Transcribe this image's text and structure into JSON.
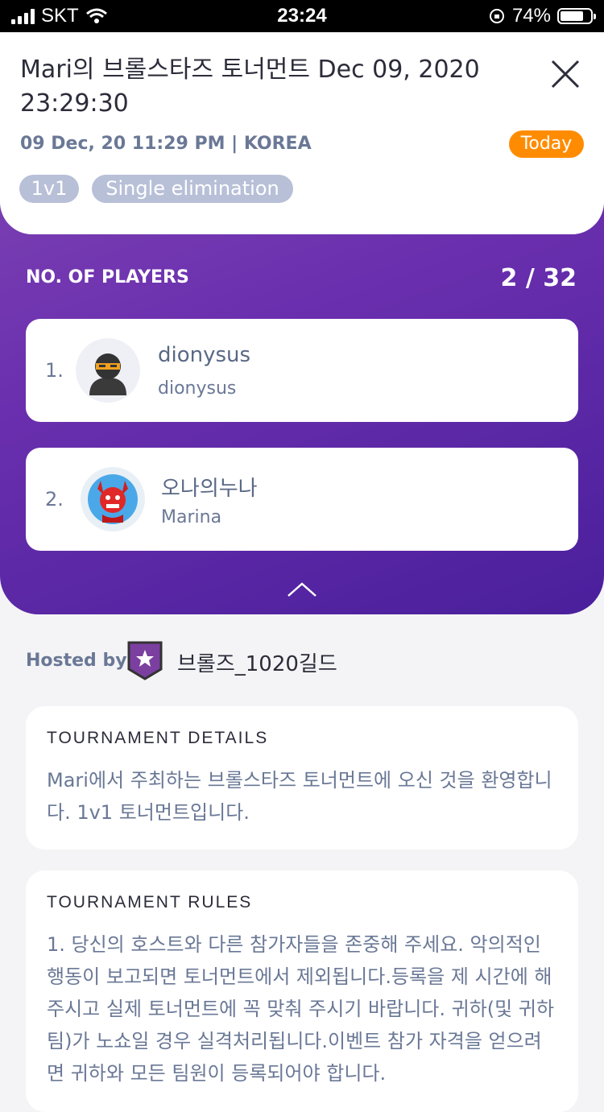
{
  "status_bar": {
    "carrier": "SKT",
    "time": "23:24",
    "battery": "74%"
  },
  "header": {
    "title": "Mari의 브롤스타즈 토너먼트 Dec 09, 2020 23:29:30",
    "meta": "09 Dec, 20 11:29 PM | KOREA",
    "badge": "Today",
    "tags": [
      "1v1",
      "Single elimination"
    ]
  },
  "players": {
    "label": "NO. OF PLAYERS",
    "count": "2 / 32",
    "list": [
      {
        "rank": "1.",
        "name": "dionysus",
        "sub": "dionysus",
        "avatar_icon": "ninja-avatar-icon"
      },
      {
        "rank": "2.",
        "name": "오나의누나",
        "sub": "Marina",
        "avatar_icon": "red-demon-avatar-icon"
      }
    ]
  },
  "host": {
    "label": "Hosted by",
    "name": "브롤즈_1020길드"
  },
  "details": {
    "title": "TOURNAMENT DETAILS",
    "text": "Mari에서 주최하는 브롤스타즈 토너먼트에 오신 것을 환영합니다. 1v1 토너먼트입니다."
  },
  "rules": {
    "title": "TOURNAMENT RULES",
    "text": "1. 당신의 호스트와 다른 참가자들을 존중해 주세요. 악의적인 행동이 보고되면 토너먼트에서 제외됩니다.등록을 제 시간에 해주시고 실제 토너먼트에 꼭 맞춰 주시기 바랍니다. 귀하(및 귀하 팀)가 노쇼일 경우 실격처리됩니다.이벤트 참가 자격을 얻으려면 귀하와 모든 팀원이 등록되어야 합니다."
  },
  "colors": {
    "accent": "#ff8c00",
    "purple": "#6a2fae",
    "tag": "#b8c0d8"
  }
}
